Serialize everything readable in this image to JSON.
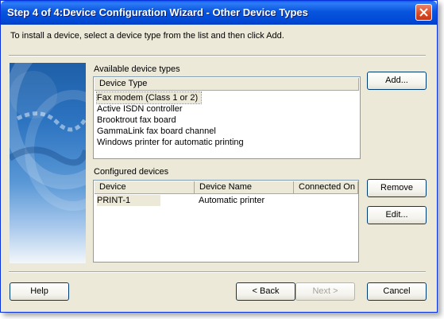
{
  "window": {
    "title": "Step 4 of 4:Device Configuration Wizard - Other Device Types",
    "instruction": "To install a device, select a device type from the list and then click Add."
  },
  "available": {
    "label": "Available device types",
    "header": "Device Type",
    "items": [
      "Fax modem (Class 1 or 2)",
      "Active ISDN controller",
      "Brooktrout fax board",
      "GammaLink fax board channel",
      "Windows printer for automatic printing"
    ],
    "selected_index": 0
  },
  "configured": {
    "label": "Configured devices",
    "headers": {
      "device": "Device",
      "device_name": "Device Name",
      "connected_on": "Connected On"
    },
    "rows": [
      {
        "device": "PRINT-1",
        "device_name": "Automatic printer",
        "connected_on": ""
      }
    ]
  },
  "buttons": {
    "add": "Add...",
    "remove": "Remove",
    "edit": "Edit...",
    "help": "Help",
    "back": "< Back",
    "next": "Next >",
    "cancel": "Cancel"
  },
  "colors": {
    "titlebar": "#0855dd",
    "dialog_bg": "#ece9d8",
    "close_button": "#d64a22"
  }
}
